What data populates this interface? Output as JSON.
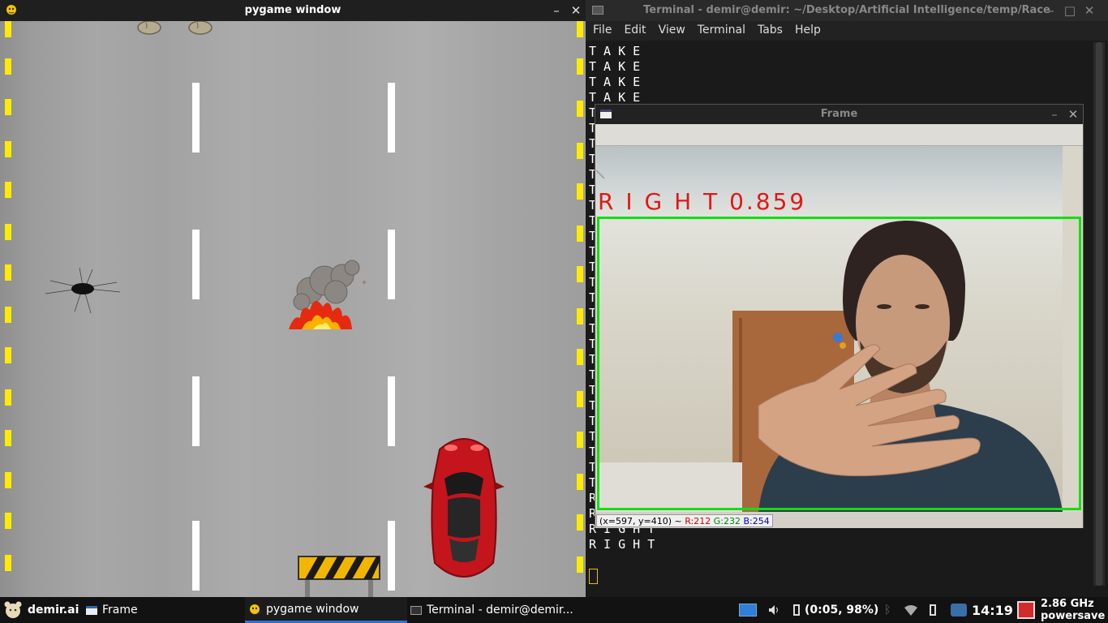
{
  "pygame": {
    "title": "pygame window"
  },
  "terminal": {
    "title": "Terminal - demir@demir: ~/Desktop/Artificial Intelligence/temp/Race",
    "menu": [
      "File",
      "Edit",
      "View",
      "Terminal",
      "Tabs",
      "Help"
    ],
    "lines_top": [
      "T A K E",
      "T A K E",
      "T A K E",
      "T A K E"
    ],
    "lines_hidden_prefix": [
      "T",
      "T",
      "T",
      "T",
      "T",
      "T",
      "T",
      "T",
      "T",
      "T",
      "T",
      "T",
      "T",
      "T",
      "T",
      "T",
      "T",
      "T",
      "T",
      "T",
      "T",
      "T",
      "T",
      "T",
      "T",
      "R"
    ],
    "lines_bottom": [
      "R I G H T",
      "R I G H T",
      "R I G H T"
    ]
  },
  "frame": {
    "title": "Frame",
    "prediction_text": "R I G H T 0.859",
    "status": {
      "coords": "(x=597, y=410) ~",
      "r": "R:212",
      "g": "G:232",
      "b": "B:254"
    }
  },
  "taskbar": {
    "user": "demir.ai",
    "items": [
      "Frame",
      "pygame window",
      "Terminal - demir@demir..."
    ],
    "battery": "(0:05, 98%)",
    "clock": "14:19",
    "cpu_freq": "2.86 GHz",
    "cpu_governor": "powersave"
  },
  "colors": {
    "prediction_red": "#e01818",
    "roi_green": "#11e011",
    "lane_yellow": "#ffeb00",
    "status_r": "#d40000",
    "status_g": "#008800",
    "status_b": "#0000cc"
  }
}
